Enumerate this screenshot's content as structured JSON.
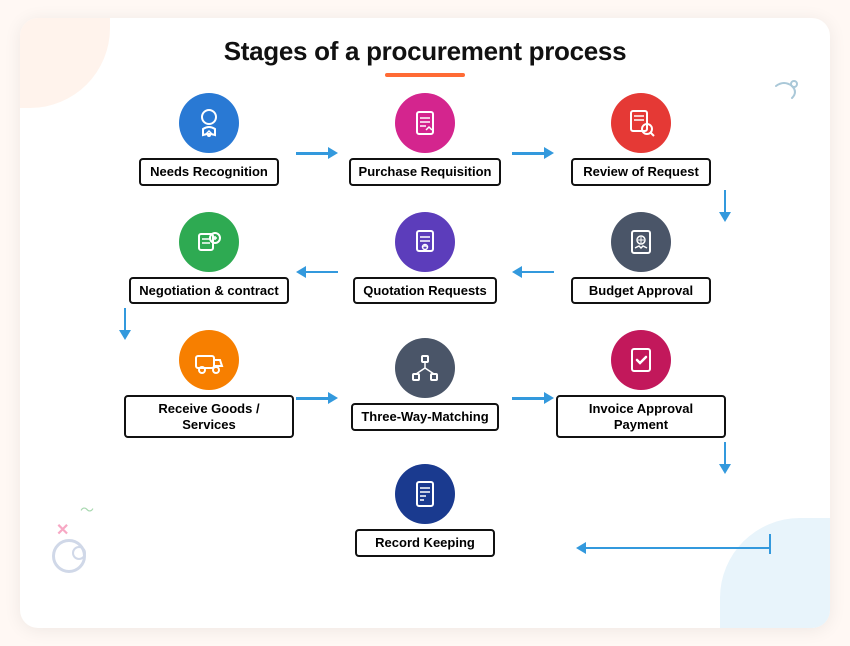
{
  "title": "Stages of a procurement process",
  "nodes": {
    "row1": [
      {
        "id": "needs-recognition",
        "label": "Needs Recognition",
        "icon": "🏅",
        "color": "icon-blue"
      },
      {
        "id": "purchase-requisition",
        "label": "Purchase Requisition",
        "icon": "📋",
        "color": "icon-magenta"
      },
      {
        "id": "review-of-request",
        "label": "Review of Request",
        "icon": "🔍",
        "color": "icon-red"
      }
    ],
    "row2": [
      {
        "id": "negotiation-contract",
        "label": "Negotiation & contract",
        "icon": "💱",
        "color": "icon-green"
      },
      {
        "id": "quotation-requests",
        "label": "Quotation Requests",
        "icon": "📄",
        "color": "icon-purple"
      },
      {
        "id": "budget-approval",
        "label": "Budget Approval",
        "icon": "💲",
        "color": "icon-darkgray"
      }
    ],
    "row3": [
      {
        "id": "receive-goods",
        "label": "Receive Goods / Services",
        "icon": "🚚",
        "color": "icon-orange"
      },
      {
        "id": "three-way-matching",
        "label": "Three-Way-Matching",
        "icon": "🔗",
        "color": "icon-charcoal"
      },
      {
        "id": "invoice-approval",
        "label": "Invoice Approval Payment",
        "icon": "✅",
        "color": "icon-pink"
      }
    ],
    "row4": [
      {
        "id": "record-keeping",
        "label": "Record Keeping",
        "icon": "📁",
        "color": "icon-navy"
      }
    ]
  },
  "arrows": {
    "row1": "right",
    "row2": "left",
    "row3": "right"
  }
}
